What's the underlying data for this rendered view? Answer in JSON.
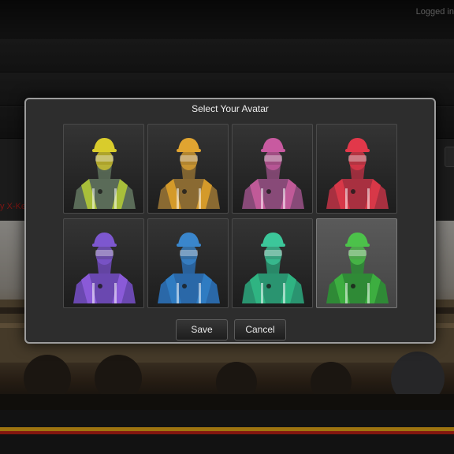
{
  "background": {
    "login_status": "Logged in",
    "left_link_fragment": "y X-Ke"
  },
  "modal": {
    "title": "Select Your Avatar",
    "save_label": "Save",
    "cancel_label": "Cancel"
  },
  "avatars": [
    {
      "color": "#d9cc2c",
      "vest": "#a8bf3a",
      "shirt": "#5a6b58",
      "selected": false
    },
    {
      "color": "#e0a431",
      "vest": "#d49a2a",
      "shirt": "#8a6a32",
      "selected": false
    },
    {
      "color": "#c85aa0",
      "vest": "#c05a98",
      "shirt": "#884a78",
      "selected": false
    },
    {
      "color": "#e2384a",
      "vest": "#d83848",
      "shirt": "#a83040",
      "selected": false
    },
    {
      "color": "#7d57cf",
      "vest": "#8a5ad8",
      "shirt": "#6a48b0",
      "selected": false
    },
    {
      "color": "#3a86cc",
      "vest": "#2f7cc2",
      "shirt": "#2a68a8",
      "selected": false
    },
    {
      "color": "#3cc79a",
      "vest": "#2fb482",
      "shirt": "#2a9470",
      "selected": false
    },
    {
      "color": "#4cc24a",
      "vest": "#3dae40",
      "shirt": "#2f8a36",
      "selected": true
    }
  ]
}
